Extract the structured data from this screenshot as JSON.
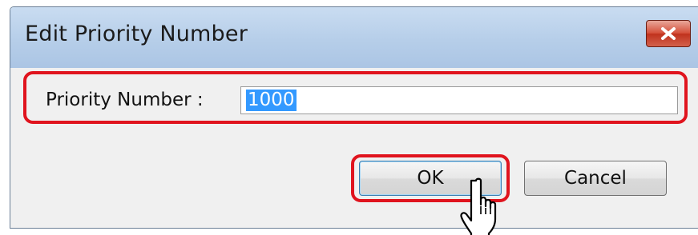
{
  "window": {
    "title": "Edit Priority Number",
    "close_icon": "close-icon"
  },
  "form": {
    "priority_label": "Priority Number :",
    "priority_value": "1000"
  },
  "buttons": {
    "ok_label": "OK",
    "cancel_label": "Cancel"
  },
  "annotations": {
    "highlight_color": "#e0141e",
    "cursor_icon": "hand-pointer-icon"
  }
}
